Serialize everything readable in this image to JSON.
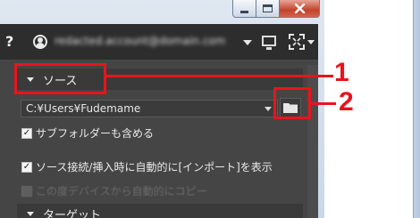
{
  "window": {
    "controls": [
      "minimize",
      "maximize",
      "close"
    ]
  },
  "topbar": {
    "help_label": "?",
    "account_text": "redacted.account@domain.com",
    "icons": [
      "help-icon",
      "user-icon",
      "monitor-icon",
      "fullscreen-icon"
    ]
  },
  "source_section": {
    "title": "ソース",
    "path_value": "C:¥Users¥Fudemame",
    "include_subfolders": {
      "label": "サブフォルダーも含める",
      "checked": true
    },
    "show_import_on_connect": {
      "label": "ソース接続/挿入時に自動的に[インポート]を表示",
      "checked": true
    },
    "auto_copy": {
      "label": "この度デバイスから自動的にコピー",
      "checked": false,
      "enabled": false
    }
  },
  "target_section": {
    "title": "ターゲット"
  },
  "annotations": [
    {
      "number": "1",
      "target": "source-section-header"
    },
    {
      "number": "2",
      "target": "browse-folder-button"
    }
  ],
  "colors": {
    "callout_red": "#e8141c",
    "panel_bg": "#454545",
    "topbar_bg": "#2d2d2d"
  }
}
